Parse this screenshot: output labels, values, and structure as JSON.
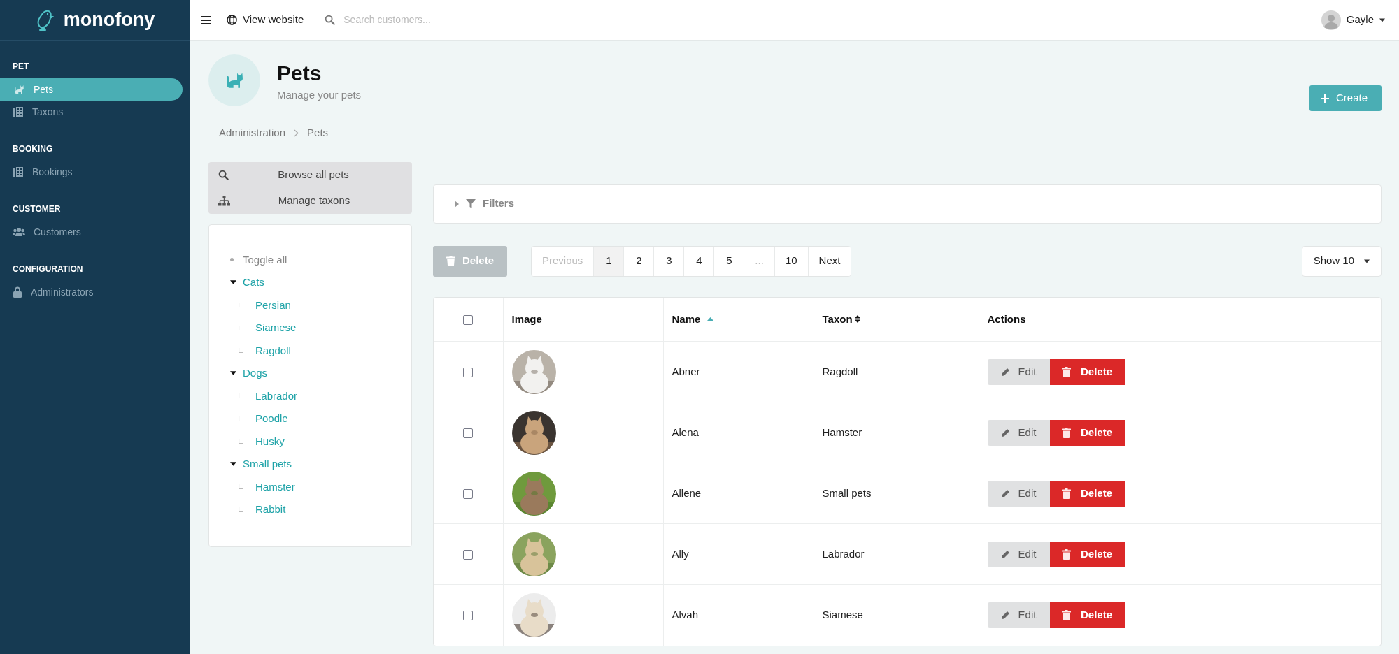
{
  "logo": {
    "text": "monofony"
  },
  "sidebar": {
    "sections": [
      {
        "heading": "PET",
        "items": [
          {
            "label": "Pets",
            "selected": true
          },
          {
            "label": "Taxons",
            "selected": false
          }
        ]
      },
      {
        "heading": "BOOKING",
        "items": [
          {
            "label": "Bookings",
            "selected": false
          }
        ]
      },
      {
        "heading": "CUSTOMER",
        "items": [
          {
            "label": "Customers",
            "selected": false
          }
        ]
      },
      {
        "heading": "CONFIGURATION",
        "items": [
          {
            "label": "Administrators",
            "selected": false
          }
        ]
      }
    ]
  },
  "topbar": {
    "view_website": "View website",
    "search": {
      "placeholder": "Search customers..."
    },
    "user": "Gayle"
  },
  "header": {
    "title": "Pets",
    "subtitle": "Manage your pets",
    "create_button": "Create"
  },
  "breadcrumb": [
    "Administration",
    "Pets"
  ],
  "side_menu": [
    "Browse all pets",
    "Manage taxons"
  ],
  "tree": {
    "toggle_all": "Toggle all",
    "nodes": [
      {
        "label": "Cats",
        "expanded": true,
        "children": [
          {
            "label": "Persian"
          },
          {
            "label": "Siamese"
          },
          {
            "label": "Ragdoll"
          }
        ]
      },
      {
        "label": "Dogs",
        "expanded": true,
        "children": [
          {
            "label": "Labrador"
          },
          {
            "label": "Poodle"
          },
          {
            "label": "Husky"
          }
        ]
      },
      {
        "label": "Small pets",
        "expanded": true,
        "children": [
          {
            "label": "Hamster"
          },
          {
            "label": "Rabbit"
          }
        ]
      }
    ]
  },
  "filters": {
    "label": "Filters",
    "expanded": false
  },
  "bulk_delete": {
    "label": "Delete",
    "disabled": true
  },
  "pagination": [
    {
      "label": "Previous",
      "selected": false,
      "disabled": true
    },
    {
      "label": "1",
      "selected": true,
      "disabled": false
    },
    {
      "label": "2",
      "selected": false,
      "disabled": false
    },
    {
      "label": "3",
      "selected": false,
      "disabled": false
    },
    {
      "label": "4",
      "selected": false,
      "disabled": false
    },
    {
      "label": "5",
      "selected": false,
      "disabled": false
    },
    {
      "label": "...",
      "selected": false,
      "disabled": true
    },
    {
      "label": "10",
      "selected": false,
      "disabled": false
    },
    {
      "label": "Next",
      "selected": false,
      "disabled": false
    }
  ],
  "per_page": "Show 10",
  "table": {
    "select_all": {
      "checked": false
    },
    "columns": [
      {
        "label": "Image",
        "sortable": false
      },
      {
        "label": "Name",
        "sortable": true,
        "sorted": true
      },
      {
        "label": "Taxon",
        "sortable": true,
        "sorted": false
      },
      {
        "label": "Actions",
        "sortable": false
      }
    ],
    "rows": [
      {
        "checked": false,
        "name": "Abner",
        "taxon": "Ragdoll",
        "edit": "Edit",
        "delete": "Delete"
      },
      {
        "checked": false,
        "name": "Alena",
        "taxon": "Hamster",
        "edit": "Edit",
        "delete": "Delete"
      },
      {
        "checked": false,
        "name": "Allene",
        "taxon": "Small pets",
        "edit": "Edit",
        "delete": "Delete"
      },
      {
        "checked": false,
        "name": "Ally",
        "taxon": "Labrador",
        "edit": "Edit",
        "delete": "Delete"
      },
      {
        "checked": false,
        "name": "Alvah",
        "taxon": "Siamese",
        "edit": "Edit",
        "delete": "Delete"
      }
    ]
  }
}
